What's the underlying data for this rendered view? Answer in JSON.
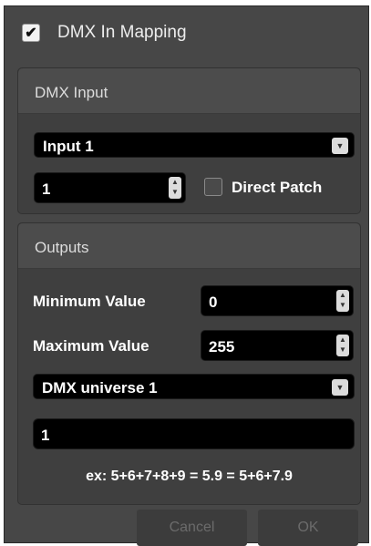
{
  "header": {
    "checked_mark": "✔",
    "title": "DMX In Mapping",
    "checked": true
  },
  "dmx_input": {
    "group_title": "DMX Input",
    "input_select": "Input 1",
    "channel_value": "1",
    "direct_patch_label": "Direct Patch",
    "direct_patch_checked": false
  },
  "outputs": {
    "group_title": "Outputs",
    "min_label": "Minimum Value",
    "min_value": "0",
    "max_label": "Maximum Value",
    "max_value": "255",
    "universe_select": "DMX universe 1",
    "channels_value": "1",
    "example_hint": "ex: 5+6+7+8+9 = 5.9 = 5+6+7.9"
  },
  "buttons": {
    "cancel": "Cancel",
    "ok": "OK"
  },
  "icons": {
    "dropdown": "dropdown-arrow-icon",
    "spinner": "spinner-arrows-icon",
    "checkbox": "checkmark-icon"
  }
}
